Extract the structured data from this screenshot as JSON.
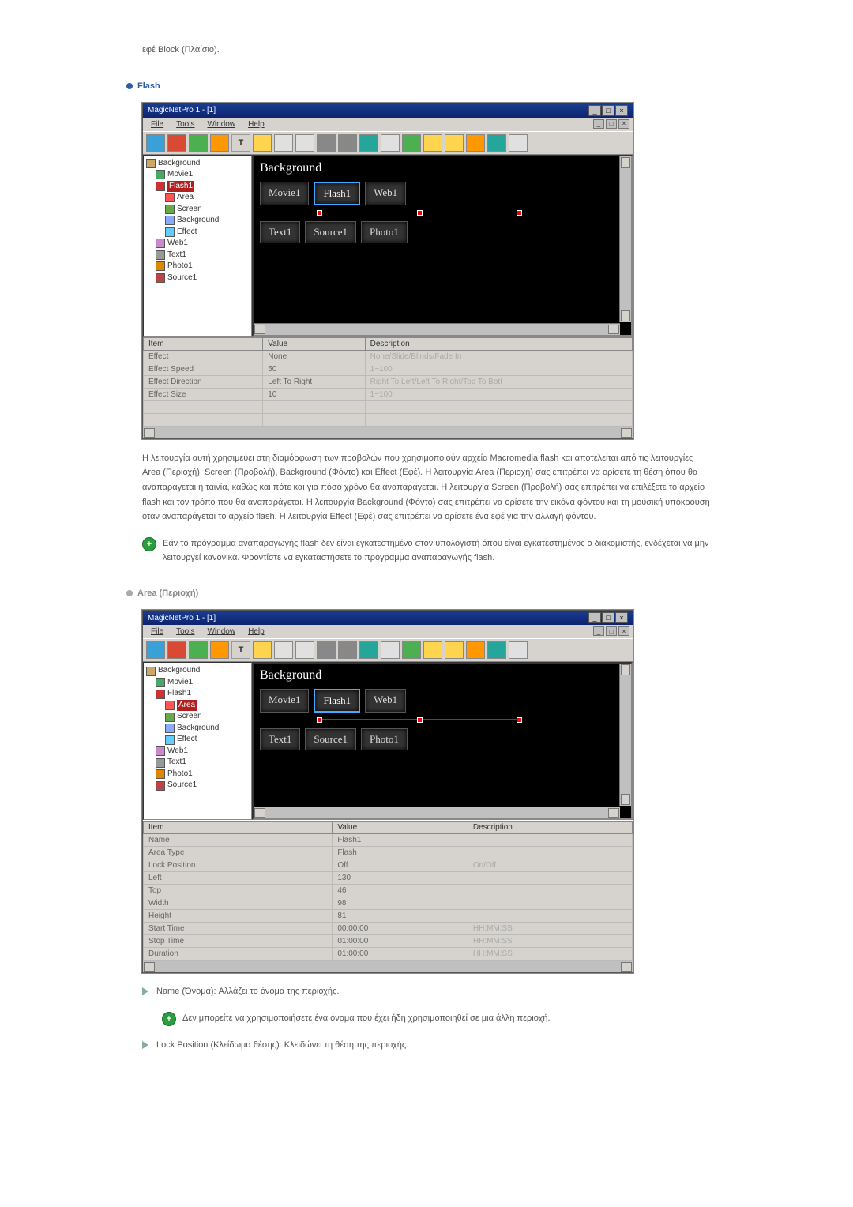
{
  "intro": "εφέ Block (Πλαίσιο).",
  "section1": {
    "title": "Flash"
  },
  "app": {
    "title": "MagicNetPro 1 - [1]",
    "menu": [
      "File",
      "Tools",
      "Window",
      "Help"
    ],
    "tree": {
      "root": "Background",
      "items": [
        "Movie1",
        "Flash1",
        "Area",
        "Screen",
        "Background",
        "Effect",
        "Web1",
        "Text1",
        "Photo1",
        "Source1"
      ],
      "sel": "Flash1"
    },
    "canvas": {
      "title": "Background",
      "row1": [
        "Movie1",
        "Flash1",
        "Web1"
      ],
      "row2": [
        "Text1",
        "Source1",
        "Photo1"
      ]
    },
    "props1": {
      "cols": [
        "Item",
        "Value",
        "Description"
      ],
      "rows": [
        [
          "Effect",
          "None",
          "None/Slide/Blinds/Fade In"
        ],
        [
          "Effect Speed",
          "50",
          "1~100"
        ],
        [
          "Effect Direction",
          "Left To Right",
          "Right To Left/Left To Right/Top To Bott"
        ],
        [
          "Effect Size",
          "10",
          "1~100"
        ]
      ]
    },
    "props2": {
      "cols": [
        "Item",
        "Value",
        "Description"
      ],
      "rows": [
        [
          "Name",
          "Flash1",
          ""
        ],
        [
          "Area Type",
          "Flash",
          ""
        ],
        [
          "Lock Position",
          "Off",
          "On/Off"
        ],
        [
          "Left",
          "130",
          ""
        ],
        [
          "Top",
          "46",
          ""
        ],
        [
          "Width",
          "98",
          ""
        ],
        [
          "Height",
          "81",
          ""
        ],
        [
          "Start Time",
          "00:00:00",
          "HH:MM:SS"
        ],
        [
          "Stop Time",
          "01:00:00",
          "HH:MM:SS"
        ],
        [
          "Duration",
          "01:00:00",
          "HH:MM:SS"
        ]
      ]
    }
  },
  "para1": "Η λειτουργία αυτή χρησιμεύει στη διαμόρφωση των προβολών που χρησιμοποιούν αρχεία Macromedia flash και αποτελείται από τις λειτουργίες Area (Περιοχή), Screen (Προβολή), Background (Φόντο) και Effect (Εφέ). Η λειτουργία Area (Περιοχή) σας επιτρέπει να ορίσετε τη θέση όπου θα αναπαράγεται η ταινία, καθώς και πότε και για πόσο χρόνο θα αναπαράγεται. Η λειτουργία Screen (Προβολή) σας επιτρέπει να επιλέξετε το αρχείο flash και τον τρόπο που θα αναπαράγεται. Η λειτουργία Background (Φόντο) σας επιτρέπει να ορίσετε την εικόνα φόντου και τη μουσική υπόκρουση όταν αναπαράγεται το αρχείο flash. Η λειτουργία Effect (Εφέ) σας επιτρέπει να ορίσετε ένα εφέ για την αλλαγή φόντου.",
  "note1": "Εάν το πρόγραμμα αναπαραγωγής flash δεν είναι εγκατεστημένο στον υπολογιστή όπου είναι εγκατεστημένος ο διακομιστής, ενδέχεται να μην λειτουργεί κανονικά. Φροντίστε να εγκαταστήσετε το πρόγραμμα αναπαραγωγής flash.",
  "section2": {
    "title": "Area (Περιοχή)"
  },
  "tree2": {
    "sel": "Area"
  },
  "list1": "Name (Όνομα): Αλλάζει το όνομα της περιοχής.",
  "subnote1": "Δεν μπορείτε να χρησιμοποιήσετε ένα όνομα που έχει ήδη χρησιμοποιηθεί σε μια άλλη περιοχή.",
  "list2": "Lock Position (Κλείδωμα θέσης): Κλειδώνει τη θέση της περιοχής."
}
